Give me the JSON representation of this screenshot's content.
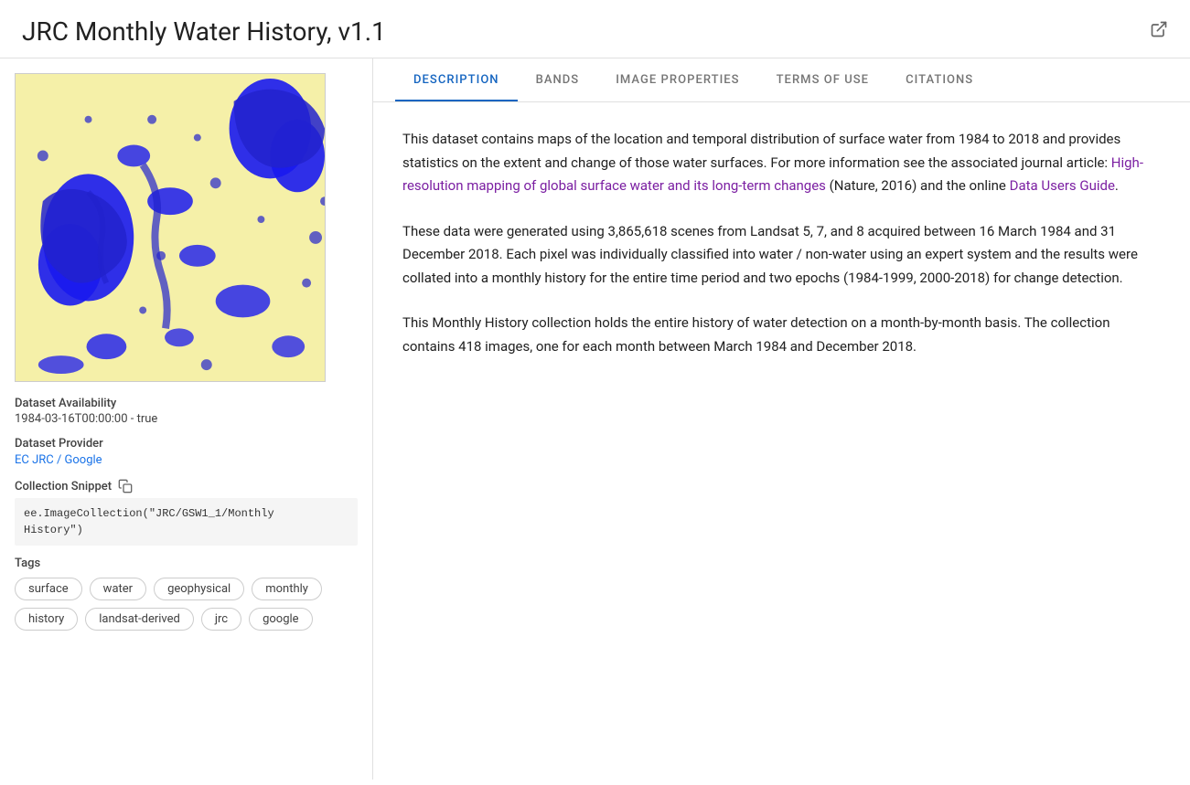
{
  "header": {
    "title": "JRC Monthly Water History, v1.1",
    "external_link_symbol": "⧉"
  },
  "left_panel": {
    "dataset_availability_label": "Dataset Availability",
    "dataset_availability_value": "1984-03-16T00:00:00 - true",
    "dataset_provider_label": "Dataset Provider",
    "dataset_provider_link_text": "EC JRC / Google",
    "dataset_provider_link_href": "#",
    "collection_snippet_label": "Collection Snippet",
    "collection_snippet_code_line1": "ee.ImageCollection(\"JRC/GSW1_1/Monthly",
    "collection_snippet_code_line2": "History\")",
    "tags_label": "Tags",
    "tags": [
      "surface",
      "water",
      "geophysical",
      "monthly",
      "history",
      "landsat-derived",
      "jrc",
      "google"
    ]
  },
  "tabs": [
    {
      "id": "description",
      "label": "DESCRIPTION",
      "active": true
    },
    {
      "id": "bands",
      "label": "BANDS",
      "active": false
    },
    {
      "id": "image-properties",
      "label": "IMAGE PROPERTIES",
      "active": false
    },
    {
      "id": "terms-of-use",
      "label": "TERMS OF USE",
      "active": false
    },
    {
      "id": "citations",
      "label": "CITATIONS",
      "active": false
    }
  ],
  "description": {
    "paragraph1_before_link1": "This dataset contains maps of the location and temporal distribution of surface water from 1984 to 2018 and provides statistics on the extent and change of those water surfaces. For more information see the associated journal article: ",
    "link1_text": "High-resolution mapping of global surface water and its long-term changes",
    "paragraph1_between_links": " (Nature, 2016) and the online ",
    "link2_text": "Data Users Guide",
    "paragraph1_after_link2": ".",
    "paragraph2": "These data were generated using 3,865,618 scenes from Landsat 5, 7, and 8 acquired between 16 March 1984 and 31 December 2018. Each pixel was individually classified into water / non-water using an expert system and the results were collated into a monthly history for the entire time period and two epochs (1984-1999, 2000-2018) for change detection.",
    "paragraph3": "This Monthly History collection holds the entire history of water detection on a month-by-month basis. The collection contains 418 images, one for each month between March 1984 and December 2018."
  }
}
